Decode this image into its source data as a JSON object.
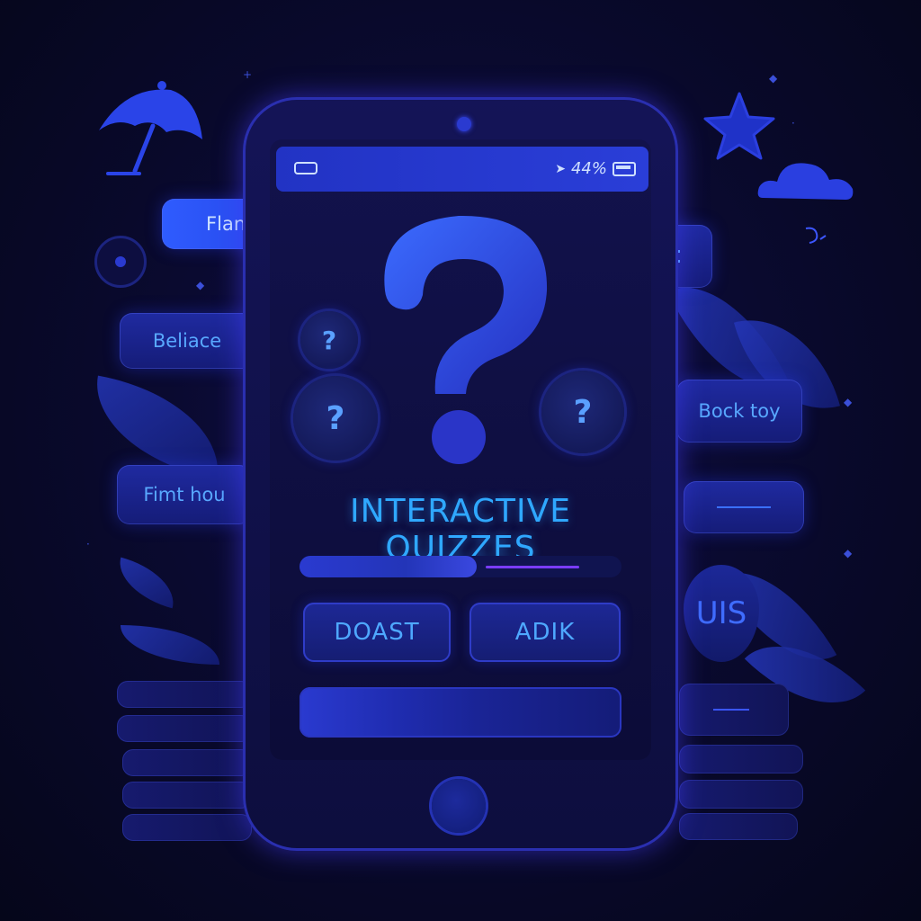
{
  "status_bar": {
    "left_icon": "battery-outline-icon",
    "signal_icon": "location-arrow-icon",
    "signal_text": "44%",
    "battery_icon": "battery-icon"
  },
  "main": {
    "title": "INTERACTIVE QUIZZES",
    "question_mark": "?",
    "small_question_marks": [
      "?",
      "?",
      "?"
    ],
    "progress": {
      "fraction": 0.55
    },
    "buttons": [
      "DOAST",
      "ADIK"
    ]
  },
  "left_bubbles": [
    "Flanee",
    "Beliace",
    "Fimt hou"
  ],
  "right_bubbles": [
    "Bock toy",
    "UIS"
  ],
  "icons": [
    "umbrella-icon",
    "star-icon",
    "cloud-icon",
    "target-icon",
    "leaf-icon",
    "message-lines-icon",
    "home-button-icon",
    "camera-icon"
  ],
  "colors": {
    "accent": "#2fa8ff",
    "primary": "#2233c4",
    "background": "#0a0a30",
    "progress_accent": "#7a3cff"
  }
}
